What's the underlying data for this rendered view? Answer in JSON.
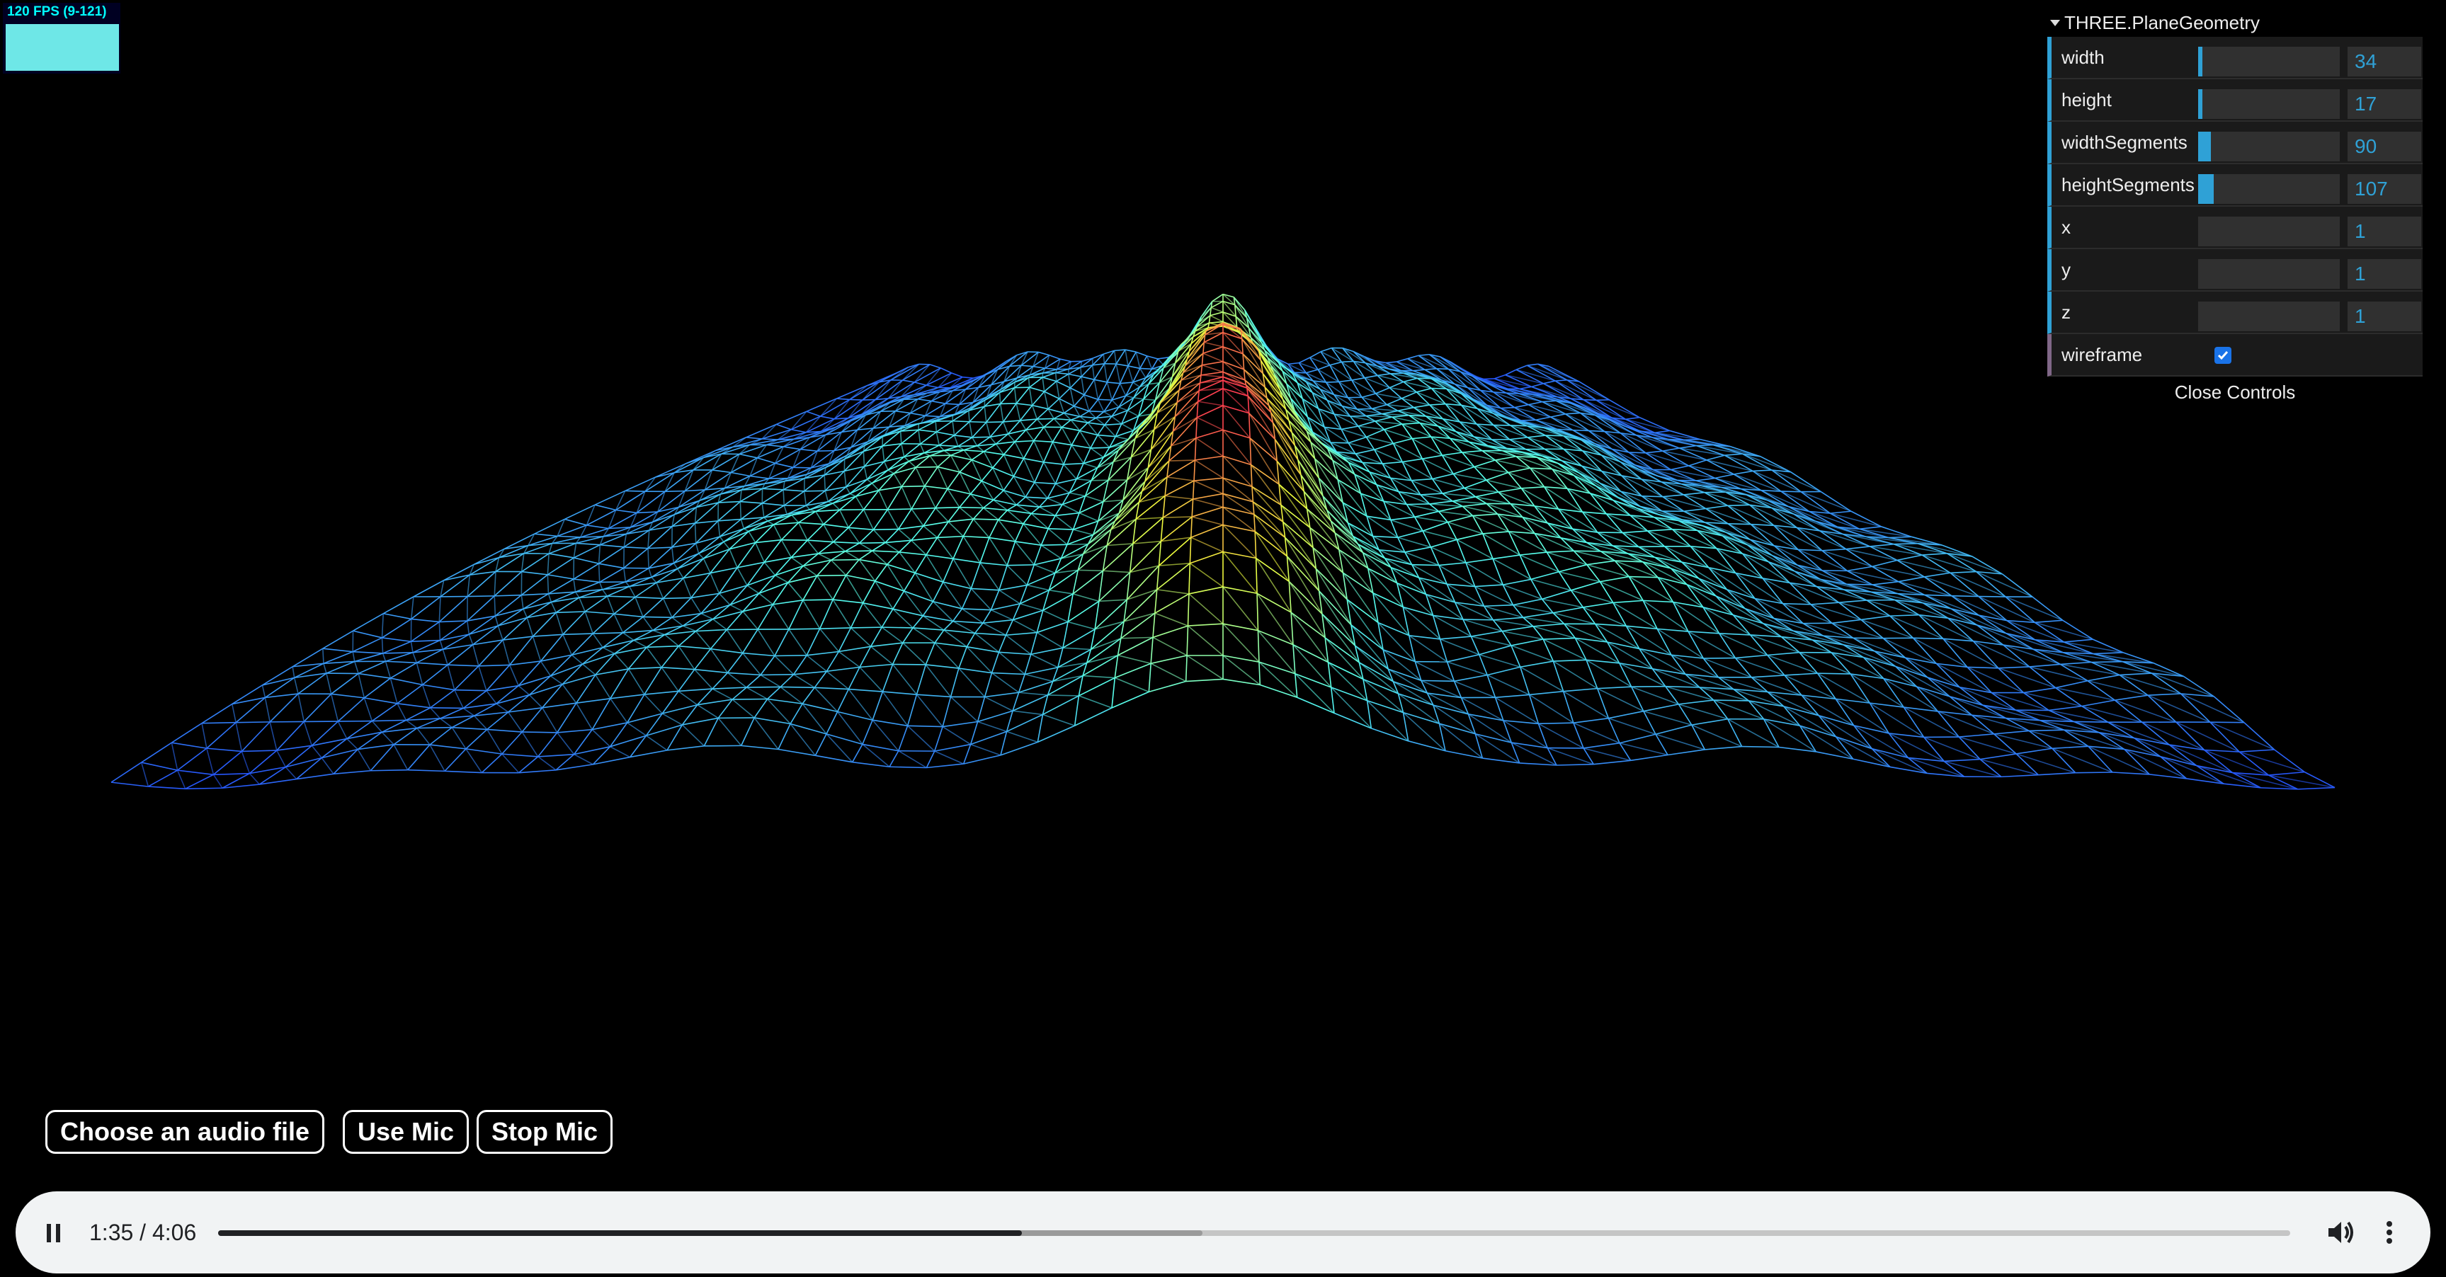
{
  "stats": {
    "fps_text": "120 FPS (9-121)"
  },
  "gui": {
    "folder_title": "THREE.PlaneGeometry",
    "controls": [
      {
        "label": "width",
        "value": "34",
        "fill": 0.03
      },
      {
        "label": "height",
        "value": "17",
        "fill": 0.02
      },
      {
        "label": "widthSegments",
        "value": "90",
        "fill": 0.09
      },
      {
        "label": "heightSegments",
        "value": "107",
        "fill": 0.11
      },
      {
        "label": "x",
        "value": "1",
        "fill": 0
      },
      {
        "label": "y",
        "value": "1",
        "fill": 0
      },
      {
        "label": "z",
        "value": "1",
        "fill": 0
      }
    ],
    "wireframe_label": "wireframe",
    "wireframe_checked": true,
    "close_label": "Close Controls"
  },
  "buttons": {
    "choose_file": "Choose an audio file",
    "use_mic": "Use Mic",
    "stop_mic": "Stop Mic"
  },
  "player": {
    "time": "1:35 / 4:06",
    "progress_played": 0.388,
    "progress_buffered": 0.475
  },
  "colors": {
    "gui_accent": "#2fa1d6",
    "fps_graph": "#6ee7e7",
    "wire_low": "#1414ff",
    "wire_mid": "#55ffee",
    "wire_peak": "#ff33cc"
  }
}
